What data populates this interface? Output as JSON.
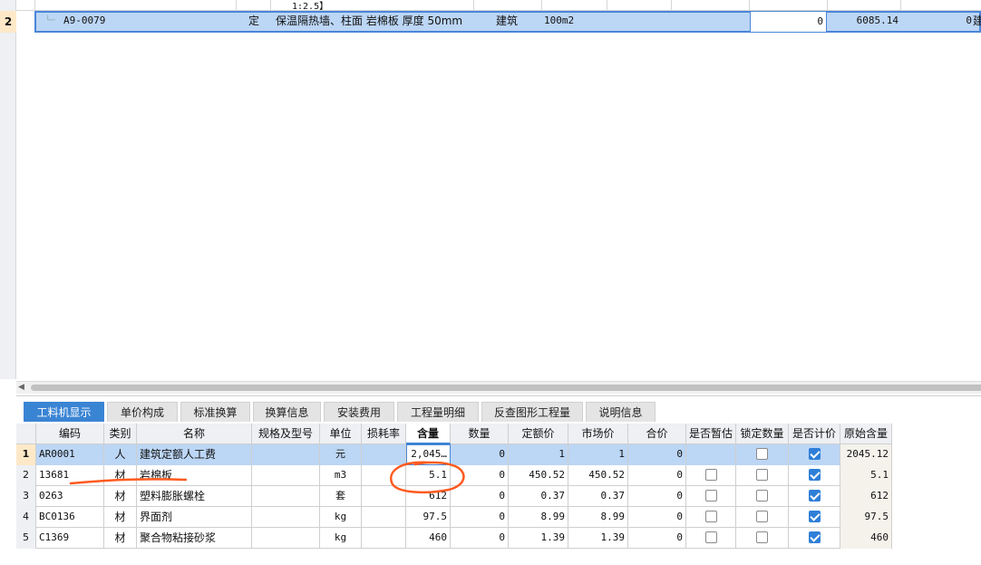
{
  "upper_grid": {
    "fragment_text": "1:2.5】",
    "row": {
      "num": "2",
      "code": "A9-0079",
      "type": "定",
      "name": "保温隔热墙、柱面 岩棉板 厚度 50mm",
      "major": "建筑",
      "unit": "100m2",
      "quantity": "0",
      "unit_price": "6085.14",
      "total": "0",
      "overflow_char": "建"
    }
  },
  "tabs": [
    "工料机显示",
    "单价构成",
    "标准换算",
    "换算信息",
    "安装费用",
    "工程量明细",
    "反查图形工程量",
    "说明信息"
  ],
  "active_tab": 0,
  "lower_grid": {
    "headers": [
      "编码",
      "类别",
      "名称",
      "规格及型号",
      "单位",
      "损耗率",
      "含量",
      "数量",
      "定额价",
      "市场价",
      "合价",
      "是否暂估",
      "锁定数量",
      "是否计价",
      "原始含量"
    ],
    "rows": [
      {
        "num": "1",
        "code": "AR0001",
        "cat": "人",
        "name": "建筑定额人工费",
        "spec": "",
        "unit": "元",
        "loss": "",
        "content": "2,045…",
        "qty": "0",
        "quota_price": "1",
        "market_price": "1",
        "total": "0",
        "is_estimate": null,
        "lock_qty": false,
        "is_priced": true,
        "orig_content": "2045.12"
      },
      {
        "num": "2",
        "code": "13681",
        "cat": "材",
        "name": "岩棉板",
        "spec": "",
        "unit": "m3",
        "loss": "",
        "content": "5.1",
        "qty": "0",
        "quota_price": "450.52",
        "market_price": "450.52",
        "total": "0",
        "is_estimate": false,
        "lock_qty": false,
        "is_priced": true,
        "orig_content": "5.1"
      },
      {
        "num": "3",
        "code": "0263",
        "cat": "材",
        "name": "塑料膨胀螺栓",
        "spec": "",
        "unit": "套",
        "loss": "",
        "content": "612",
        "qty": "0",
        "quota_price": "0.37",
        "market_price": "0.37",
        "total": "0",
        "is_estimate": false,
        "lock_qty": false,
        "is_priced": true,
        "orig_content": "612"
      },
      {
        "num": "4",
        "code": "BC0136",
        "cat": "材",
        "name": "界面剂",
        "spec": "",
        "unit": "kg",
        "loss": "",
        "content": "97.5",
        "qty": "0",
        "quota_price": "8.99",
        "market_price": "8.99",
        "total": "0",
        "is_estimate": false,
        "lock_qty": false,
        "is_priced": true,
        "orig_content": "97.5"
      },
      {
        "num": "5",
        "code": "C1369",
        "cat": "材",
        "name": "聚合物粘接砂浆",
        "spec": "",
        "unit": "kg",
        "loss": "",
        "content": "460",
        "qty": "0",
        "quota_price": "1.39",
        "market_price": "1.39",
        "total": "0",
        "is_estimate": false,
        "lock_qty": false,
        "is_priced": true,
        "orig_content": "460"
      }
    ]
  },
  "colors": {
    "accent": "#3a84d4",
    "selection": "#bcd6f5",
    "annotation": "#ff5a1f"
  }
}
